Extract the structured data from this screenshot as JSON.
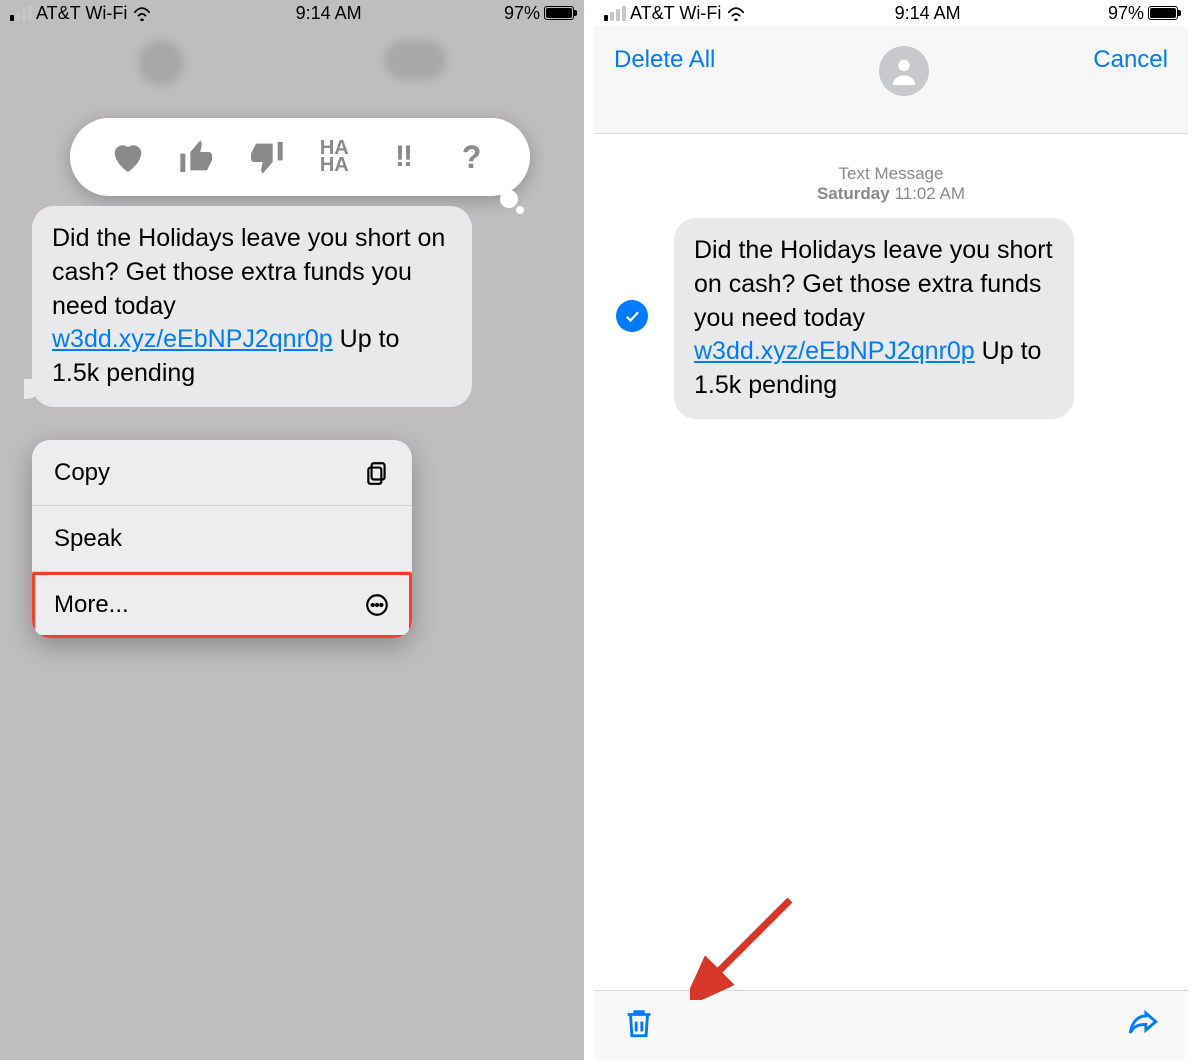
{
  "status": {
    "carrier": "AT&T Wi-Fi",
    "time": "9:14 AM",
    "battery_pct": "97%"
  },
  "left": {
    "tapbacks": [
      "heart",
      "thumbs-up",
      "thumbs-down",
      "haha",
      "exclaim",
      "question"
    ],
    "message": {
      "pre": "Did the Holidays leave you short on cash? Get those extra funds you need today ",
      "link": "w3dd.xyz/eEbNPJ2qnr0p",
      "post": " Up to 1.5k pending"
    },
    "menu": {
      "copy": "Copy",
      "speak": "Speak",
      "more": "More..."
    }
  },
  "right": {
    "header": {
      "delete_all": "Delete All",
      "cancel": "Cancel"
    },
    "thread_label": "Text Message",
    "thread_day": "Saturday",
    "thread_time": "11:02 AM",
    "message": {
      "pre": "Did the Holidays leave you short on cash? Get those extra funds you need today ",
      "link": "w3dd.xyz/eEbNPJ2qnr0p",
      "post": " Up to 1.5k pending"
    }
  }
}
